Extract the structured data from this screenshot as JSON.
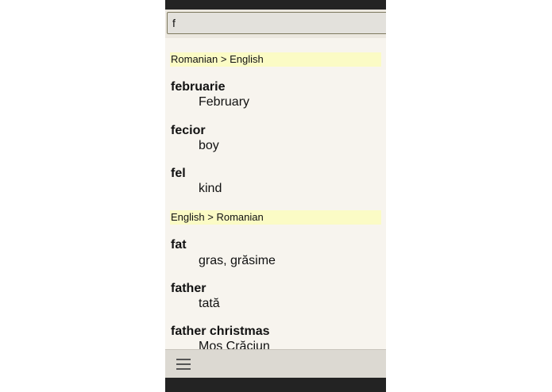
{
  "search": {
    "value": "f",
    "placeholder": ""
  },
  "sections": [
    {
      "header": "Romanian > English",
      "entries": [
        {
          "word": "februarie",
          "definition": "February"
        },
        {
          "word": "fecior",
          "definition": "boy"
        },
        {
          "word": "fel",
          "definition": "kind"
        }
      ]
    },
    {
      "header": "English > Romanian",
      "entries": [
        {
          "word": "fat",
          "definition": "gras, grăsime"
        },
        {
          "word": "father",
          "definition": "tată"
        },
        {
          "word": "father christmas",
          "definition": "Moș Crăciun"
        }
      ]
    }
  ],
  "bottom_bar": {
    "menu_icon": "hamburger-menu-icon"
  },
  "colors": {
    "background": "#f7f4ee",
    "section_header_bg": "#fbfbc5",
    "bottom_bar_bg": "#dcd9d2",
    "system_bar": "#232323"
  }
}
